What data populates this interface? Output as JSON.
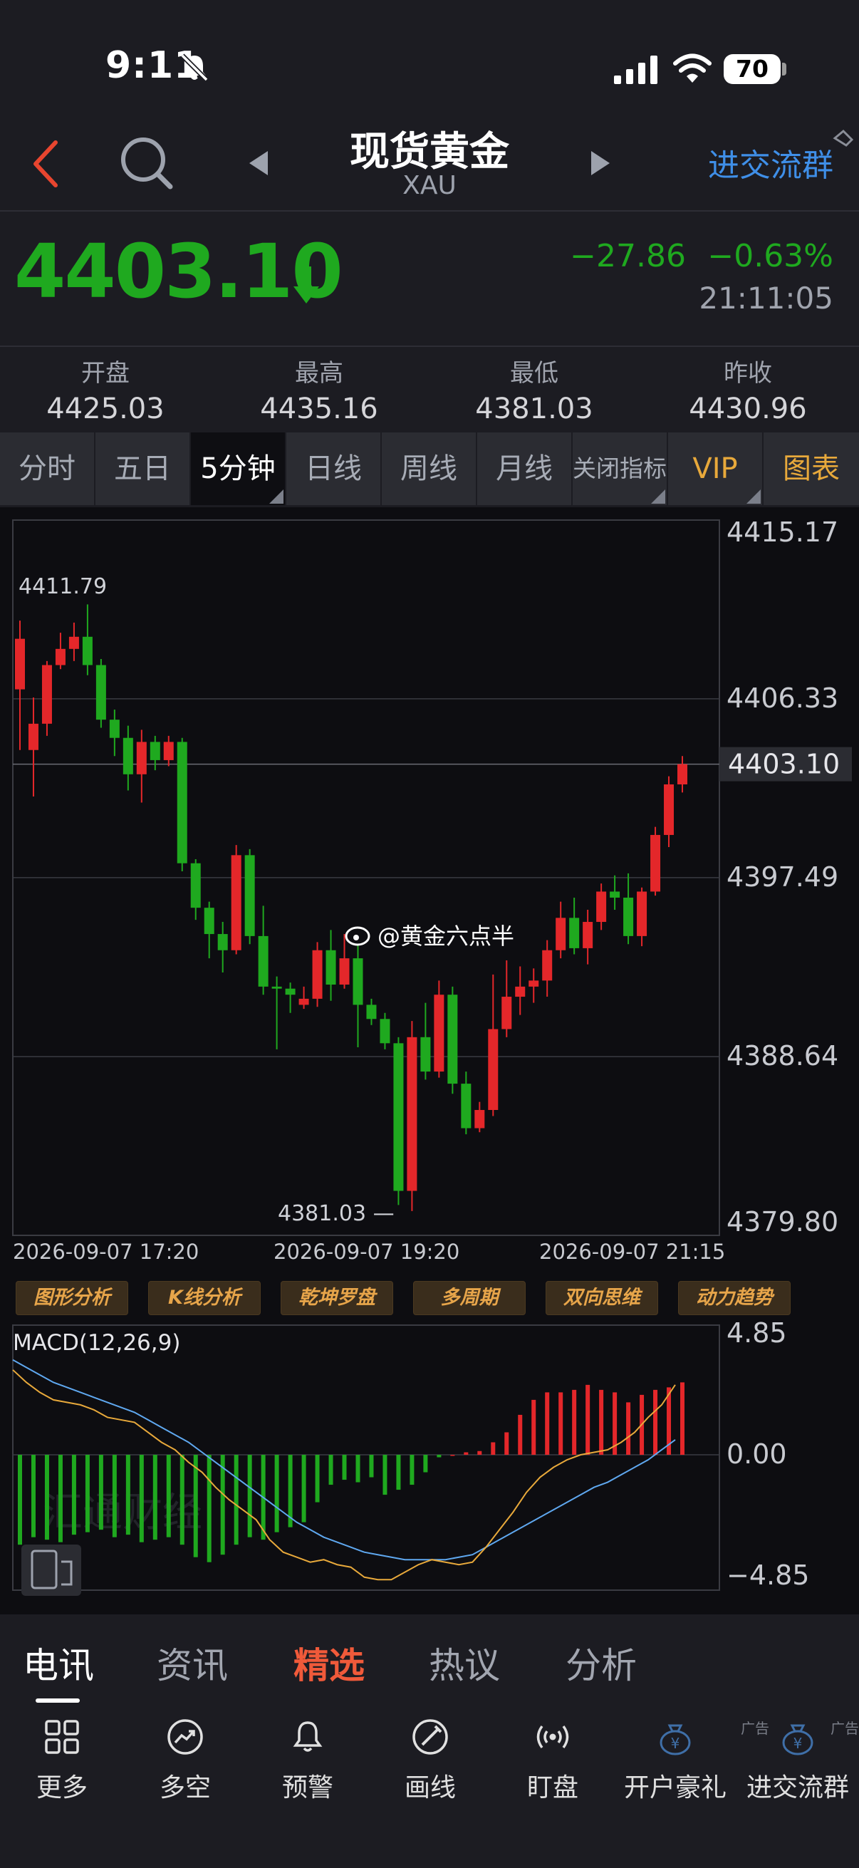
{
  "status_bar": {
    "time": "9:11",
    "battery": "70"
  },
  "header": {
    "title": "现货黄金",
    "subtitle": "XAU",
    "right_link": "进交流群"
  },
  "quote": {
    "price": "4403.10",
    "change": "−27.86",
    "change_pct": "−0.63%",
    "time": "21:11:05",
    "down_color": "#1fa91f",
    "up_color": "#e4272a"
  },
  "ohlc": [
    {
      "label": "开盘",
      "value": "4425.03"
    },
    {
      "label": "最高",
      "value": "4435.16"
    },
    {
      "label": "最低",
      "value": "4381.03"
    },
    {
      "label": "昨收",
      "value": "4430.96"
    }
  ],
  "tabs": [
    "分时",
    "五日",
    "5分钟",
    "日线",
    "周线",
    "月线",
    "关闭指标",
    "VIP",
    "图表"
  ],
  "active_tab": "5分钟",
  "chart_data": [
    {
      "type": "candlestick",
      "interval": "5分钟",
      "y_ticks": [
        "4415.17",
        "4406.33",
        "4397.49",
        "4388.64",
        "4379.80"
      ],
      "ylim": [
        4379.8,
        4415.17
      ],
      "x_ticks": [
        "2026-09-07 17:20",
        "2026-09-07 19:20",
        "2026-09-07 21:15"
      ],
      "current_price_label": "4403.10",
      "high_label": "4411.79",
      "low_label": "4381.03 —",
      "watermark": "@黄金六点半",
      "candles": [
        [
          4406.8,
          4409.3,
          4403.8,
          4410.2
        ],
        [
          4403.8,
          4405.1,
          4401.5,
          4406.4
        ],
        [
          4405.1,
          4408.0,
          4404.5,
          4408.2
        ],
        [
          4408.0,
          4408.8,
          4407.8,
          4409.6
        ],
        [
          4408.8,
          4409.4,
          4408.2,
          4410.1
        ],
        [
          4409.4,
          4408.0,
          4407.5,
          4411.0
        ],
        [
          4408.0,
          4405.3,
          4404.9,
          4408.3
        ],
        [
          4405.3,
          4404.4,
          4403.5,
          4405.8
        ],
        [
          4404.4,
          4402.6,
          4401.8,
          4405.0
        ],
        [
          4402.6,
          4404.2,
          4401.2,
          4404.8
        ],
        [
          4404.2,
          4403.3,
          4402.8,
          4404.5
        ],
        [
          4403.3,
          4404.2,
          4403.0,
          4404.5
        ],
        [
          4404.2,
          4398.2,
          4397.8,
          4404.4
        ],
        [
          4398.2,
          4396.0,
          4395.4,
          4398.4
        ],
        [
          4396.0,
          4394.7,
          4393.5,
          4396.3
        ],
        [
          4394.7,
          4393.9,
          4392.8,
          4395.3
        ],
        [
          4393.9,
          4398.6,
          4393.7,
          4399.1
        ],
        [
          4398.6,
          4394.6,
          4394.2,
          4398.9
        ],
        [
          4394.6,
          4392.1,
          4391.7,
          4396.1
        ],
        [
          4392.1,
          4392.0,
          4389.0,
          4392.6
        ],
        [
          4392.0,
          4391.7,
          4390.8,
          4392.3
        ],
        [
          4391.2,
          4391.5,
          4391.0,
          4392.1
        ],
        [
          4391.5,
          4393.9,
          4391.1,
          4394.3
        ],
        [
          4393.9,
          4392.2,
          4391.4,
          4394.9
        ],
        [
          4392.2,
          4393.5,
          4392.0,
          4394.7
        ],
        [
          4393.5,
          4391.2,
          4389.1,
          4394.2
        ],
        [
          4391.2,
          4390.5,
          4390.2,
          4391.5
        ],
        [
          4390.5,
          4389.3,
          4389.0,
          4390.8
        ],
        [
          4389.3,
          4382.0,
          4381.3,
          4389.6
        ],
        [
          4382.0,
          4389.6,
          4381.0,
          4390.4
        ],
        [
          4389.6,
          4387.9,
          4387.5,
          4391.3
        ],
        [
          4387.9,
          4391.7,
          4387.6,
          4392.4
        ],
        [
          4391.7,
          4387.3,
          4386.8,
          4392.1
        ],
        [
          4387.3,
          4385.1,
          4384.8,
          4387.9
        ],
        [
          4385.1,
          4386.0,
          4384.9,
          4386.4
        ],
        [
          4386.0,
          4390.0,
          4385.7,
          4392.7
        ],
        [
          4390.0,
          4391.6,
          4389.6,
          4393.4
        ],
        [
          4391.6,
          4392.1,
          4390.7,
          4393.1
        ],
        [
          4392.1,
          4392.4,
          4391.3,
          4393.0
        ],
        [
          4392.4,
          4393.9,
          4391.6,
          4394.4
        ],
        [
          4393.9,
          4395.5,
          4393.5,
          4396.3
        ],
        [
          4395.5,
          4394.0,
          4393.7,
          4396.5
        ],
        [
          4394.0,
          4395.3,
          4393.2,
          4395.9
        ],
        [
          4395.3,
          4396.8,
          4394.9,
          4397.2
        ],
        [
          4396.8,
          4396.5,
          4395.9,
          4397.6
        ],
        [
          4396.5,
          4394.6,
          4394.2,
          4397.7
        ],
        [
          4394.6,
          4396.8,
          4394.1,
          4397.0
        ],
        [
          4396.8,
          4399.6,
          4396.6,
          4400.0
        ],
        [
          4399.6,
          4402.1,
          4399.0,
          4402.5
        ],
        [
          4402.1,
          4403.1,
          4401.7,
          4403.5
        ]
      ]
    },
    {
      "type": "macd",
      "title": "MACD(12,26,9)",
      "y_ticks": [
        "4.85",
        "0.00",
        "−4.85"
      ],
      "ylim": [
        -4.85,
        4.85
      ],
      "histogram": [
        -3.6,
        -3.3,
        -3.4,
        -3.5,
        -3.2,
        -3.1,
        -3.0,
        -3.3,
        -3.2,
        -3.5,
        -3.4,
        -3.3,
        -3.6,
        -4.1,
        -4.3,
        -4.0,
        -3.6,
        -3.3,
        -3.4,
        -3.1,
        -2.9,
        -2.7,
        -1.9,
        -1.2,
        -1.0,
        -1.1,
        -0.9,
        -1.6,
        -1.4,
        -1.2,
        -0.7,
        -0.1,
        0.0,
        0.1,
        0.15,
        0.5,
        0.9,
        1.6,
        2.2,
        2.5,
        2.5,
        2.6,
        2.8,
        2.6,
        2.5,
        2.1,
        2.4,
        2.6,
        2.7,
        2.9
      ],
      "dif": [
        3.4,
        2.9,
        2.5,
        2.2,
        2.1,
        2.0,
        1.8,
        1.5,
        1.4,
        1.3,
        0.9,
        0.5,
        0.2,
        -0.3,
        -0.7,
        -1.3,
        -1.8,
        -2.2,
        -2.6,
        -3.4,
        -3.9,
        -4.1,
        -4.3,
        -4.2,
        -4.4,
        -4.5,
        -4.9,
        -5.0,
        -5.0,
        -4.7,
        -4.4,
        -4.2,
        -4.3,
        -4.4,
        -4.3,
        -3.7,
        -3.0,
        -2.3,
        -1.5,
        -0.9,
        -0.5,
        -0.2,
        0.0,
        0.1,
        0.2,
        0.5,
        0.9,
        1.5,
        2.0,
        2.8
      ],
      "dea": [
        3.8,
        3.5,
        3.2,
        2.9,
        2.7,
        2.5,
        2.3,
        2.1,
        1.9,
        1.7,
        1.4,
        1.1,
        0.8,
        0.5,
        0.1,
        -0.3,
        -0.7,
        -1.1,
        -1.5,
        -1.9,
        -2.3,
        -2.7,
        -3.0,
        -3.3,
        -3.5,
        -3.7,
        -3.9,
        -4.0,
        -4.1,
        -4.2,
        -4.2,
        -4.2,
        -4.2,
        -4.1,
        -4.0,
        -3.7,
        -3.4,
        -3.1,
        -2.8,
        -2.5,
        -2.2,
        -1.9,
        -1.6,
        -1.3,
        -1.1,
        -0.8,
        -0.5,
        -0.2,
        0.2,
        0.6
      ],
      "dif_color": "#e8a93b",
      "dea_color": "#5fa8f0",
      "watermark": "汇通财经"
    }
  ],
  "analysis_tools": [
    "图形分析",
    "K线分析",
    "乾坤罗盘",
    "多周期",
    "双向思维",
    "动力趋势"
  ],
  "news_tabs": [
    "电讯",
    "资讯",
    "精选",
    "热议",
    "分析"
  ],
  "active_news_tab": "电讯",
  "toolbar": [
    {
      "label": "更多",
      "icon": "grid-icon"
    },
    {
      "label": "多空",
      "icon": "trend-circle-icon"
    },
    {
      "label": "预警",
      "icon": "bell-icon"
    },
    {
      "label": "画线",
      "icon": "pen-circle-icon"
    },
    {
      "label": "盯盘",
      "icon": "broadcast-icon"
    },
    {
      "label": "开户豪礼",
      "icon": "yen-bag-icon",
      "ad": "广告"
    },
    {
      "label": "进交流群",
      "icon": "yen-bag-icon",
      "ad": "广告"
    }
  ]
}
